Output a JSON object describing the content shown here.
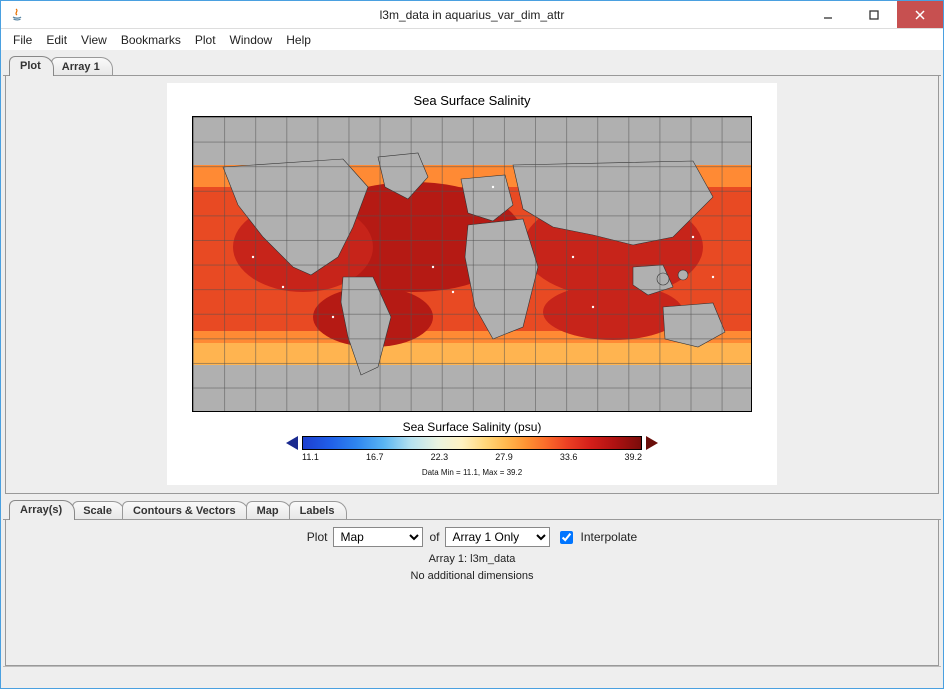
{
  "window": {
    "title": "l3m_data in aquarius_var_dim_attr"
  },
  "menubar": [
    "File",
    "Edit",
    "View",
    "Bookmarks",
    "Plot",
    "Window",
    "Help"
  ],
  "top_tabs": {
    "active": "Plot",
    "items": [
      "Plot",
      "Array 1"
    ]
  },
  "plot": {
    "title": "Sea Surface Salinity",
    "axis_caption": "Sea Surface Salinity (psu)",
    "minmax_text": "Data Min = 11.1, Max = 39.2"
  },
  "chart_data": {
    "type": "heatmap",
    "title": "Sea Surface Salinity",
    "xlabel": "",
    "ylabel": "",
    "projection": "equirectangular",
    "lon_range": [
      -180,
      180
    ],
    "lat_range": [
      -90,
      90
    ],
    "grid_step_lon": 20,
    "grid_step_lat": 15,
    "colorbar": {
      "label": "Sea Surface Salinity (psu)",
      "ticks": [
        11.1,
        16.7,
        22.3,
        27.9,
        33.6,
        39.2
      ],
      "min": 11.1,
      "max": 39.2,
      "low_arrow_color": "#1a2a90",
      "high_arrow_color": "#6a0e0a",
      "gradient_stops": [
        "#1d3fcf",
        "#205fe8",
        "#2f87ef",
        "#5ab5f2",
        "#b6e2f0",
        "#eaf3e0",
        "#fff2c2",
        "#ffd77a",
        "#ffb94f",
        "#ff9333",
        "#fb6b2a",
        "#ec4124",
        "#d41f1a",
        "#b01212",
        "#7a0c0a"
      ]
    },
    "land_color": "#b0b0b0",
    "notes": "Global map; ocean pixels colored by salinity. Open oceans ~33–37 psu (orange→red→dark red); high-latitude / coastal dilution lower (yellow–orange); very low values (blue) only near colorbar low arrow."
  },
  "bottom_tabs": {
    "active": "Array(s)",
    "items": [
      "Array(s)",
      "Scale",
      "Contours & Vectors",
      "Map",
      "Labels"
    ]
  },
  "controls": {
    "plot_label": "Plot",
    "plot_select_value": "Map",
    "of_label": "of",
    "of_select_value": "Array 1 Only",
    "interpolate_checked": true,
    "interpolate_label": "Interpolate",
    "array_line": "Array 1: l3m_data",
    "nodim_line": "No additional dimensions"
  }
}
